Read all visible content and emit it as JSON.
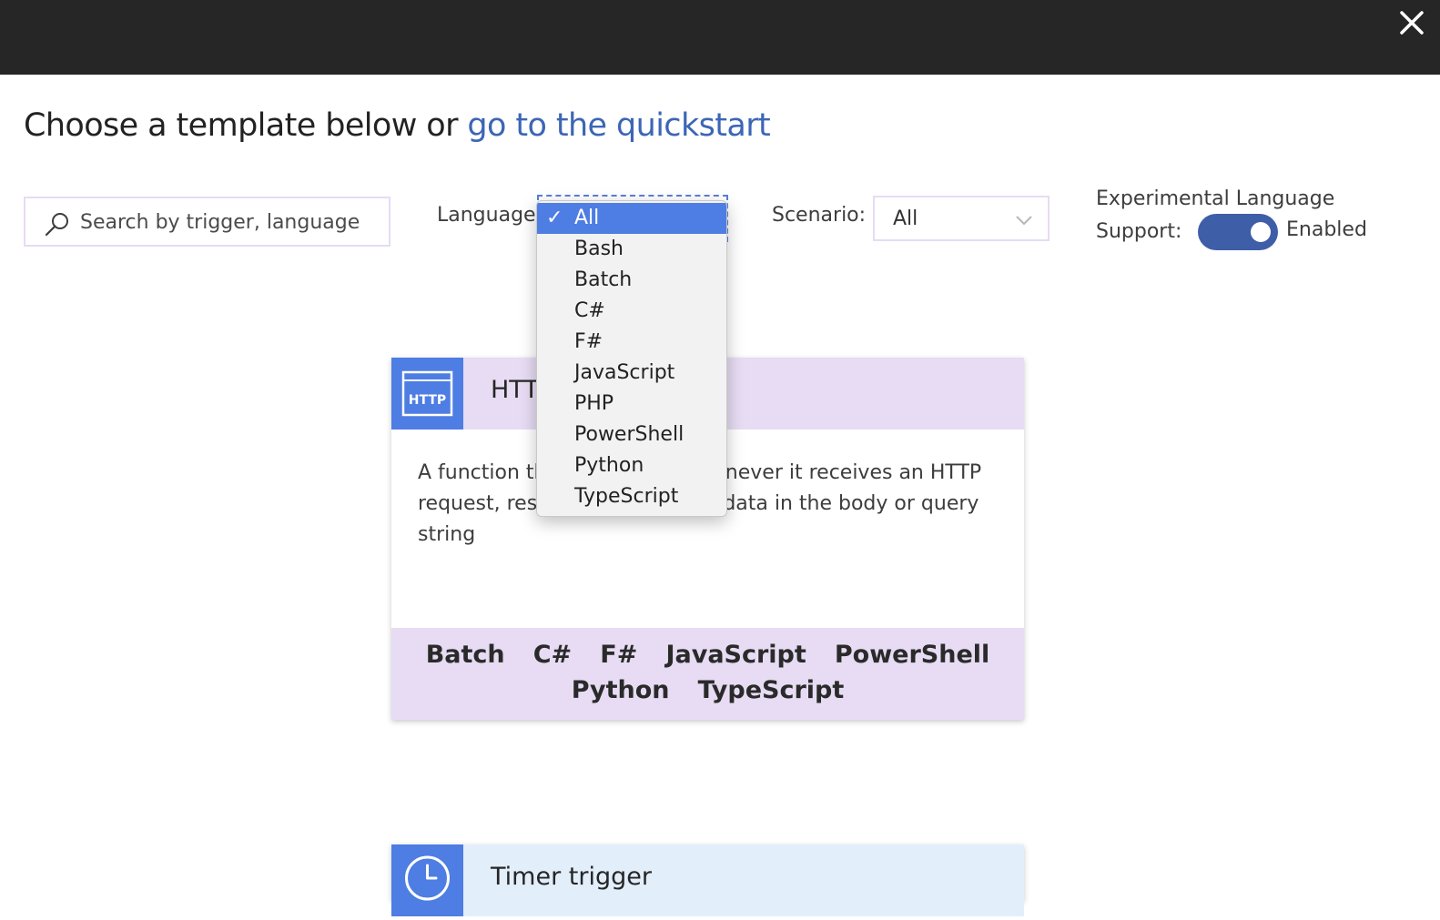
{
  "header": {
    "close_icon": "close-icon"
  },
  "heading": {
    "prefix": "Choose a template below or ",
    "link": "go to the quickstart"
  },
  "filters": {
    "search_placeholder": "Search by trigger, language",
    "search_icon": "search-icon",
    "language_label": "Language:",
    "language_options": [
      "All",
      "Bash",
      "Batch",
      "C#",
      "F#",
      "JavaScript",
      "PHP",
      "PowerShell",
      "Python",
      "TypeScript"
    ],
    "language_selected": "All",
    "scenario_label": "Scenario:",
    "scenario_value": "All",
    "experimental_label": "Experimental Language Support:",
    "experimental_value": "Enabled",
    "experimental_enabled": true
  },
  "cards": [
    {
      "icon": "http-icon",
      "icon_text": "HTTP",
      "title": "HTTP trigger",
      "description": "A function that will be run whenever it receives an HTTP request, responding based on data in the body or query string",
      "languages": [
        "Batch",
        "C#",
        "F#",
        "JavaScript",
        "PowerShell",
        "Python",
        "TypeScript"
      ],
      "header_color": "#e7dcf3"
    },
    {
      "icon": "clock-icon",
      "title": "Timer trigger",
      "header_color": "#e3eefb"
    }
  ],
  "colors": {
    "topbar": "#262626",
    "link": "#3c66b5",
    "accent": "#4e7de3",
    "toggle": "#3f5ea8"
  }
}
